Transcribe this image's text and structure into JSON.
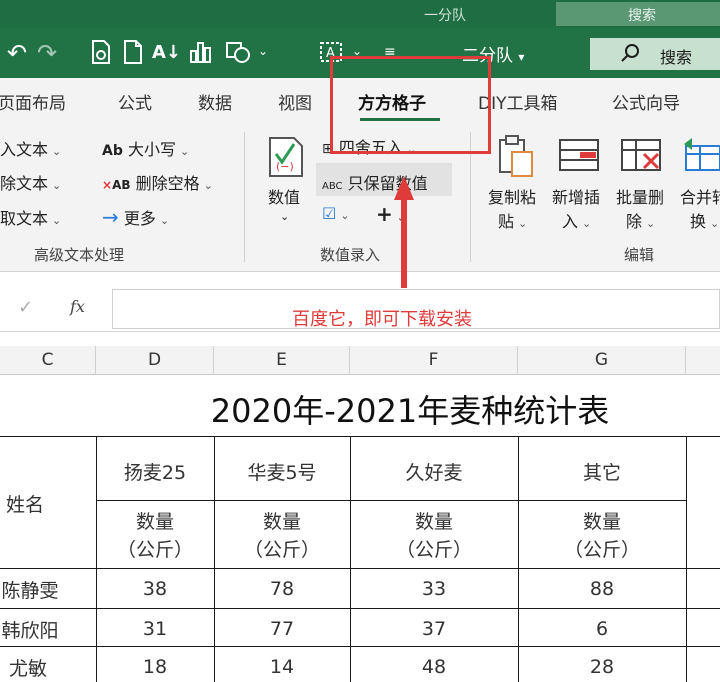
{
  "ghost_bar": {
    "title": "一分队",
    "search": "搜索"
  },
  "titlebar": {
    "doc_title": "二分队",
    "doc_title_chevron": "▾",
    "search_label": "搜索",
    "qat_icons": [
      "save-as-icon",
      "new-file-icon",
      "sort-az-icon",
      "bar-chart-icon",
      "shapes-icon",
      "text-box-icon",
      "customize-qat-icon"
    ]
  },
  "tabs": [
    "页面布局",
    "公式",
    "数据",
    "视图",
    "方方格子",
    "DIY工具箱",
    "公式向导"
  ],
  "ribbon": {
    "text_group": {
      "items": [
        "入文本",
        "除文本",
        "取文本"
      ],
      "case_label": "大小写",
      "case_icon_text": "Ab",
      "trim_label": "删除空格",
      "trim_icon_text": "AB",
      "more_label": "更多",
      "group_label": "高级文本处理"
    },
    "number_group": {
      "numeric_label": "数值",
      "round_label": "四舍五入",
      "keep_label": "只保留数值",
      "keep_icon_text": "ABC",
      "group_label": "数值录入"
    },
    "edit_group": {
      "copy_paste": [
        "复制粘",
        "贴"
      ],
      "insert": [
        "新增插",
        "入"
      ],
      "batch_delete": [
        "批量删",
        "除"
      ],
      "merge": [
        "合并转",
        "换"
      ],
      "group_label": "编辑"
    }
  },
  "formula_bar": {
    "fx": "fx",
    "check": "✓"
  },
  "annotation": "百度它，即可下载安装",
  "columns": [
    "C",
    "D",
    "E",
    "F",
    "G"
  ],
  "sheet": {
    "title": "2020年-2021年麦种统计表",
    "name_header": "姓名",
    "varieties": [
      "扬麦25",
      "华麦5号",
      "久好麦",
      "其它"
    ],
    "qty_label": "数量",
    "unit_label": "（公斤）",
    "rows": [
      {
        "name": "陈静雯",
        "values": [
          "38",
          "78",
          "33",
          "88"
        ]
      },
      {
        "name": "韩欣阳",
        "values": [
          "31",
          "77",
          "37",
          "6"
        ]
      },
      {
        "name": "尤敏",
        "values": [
          "18",
          "14",
          "48",
          "28"
        ]
      }
    ]
  },
  "colors": {
    "excel_green": "#217346",
    "accent_red": "#e03b3b"
  }
}
